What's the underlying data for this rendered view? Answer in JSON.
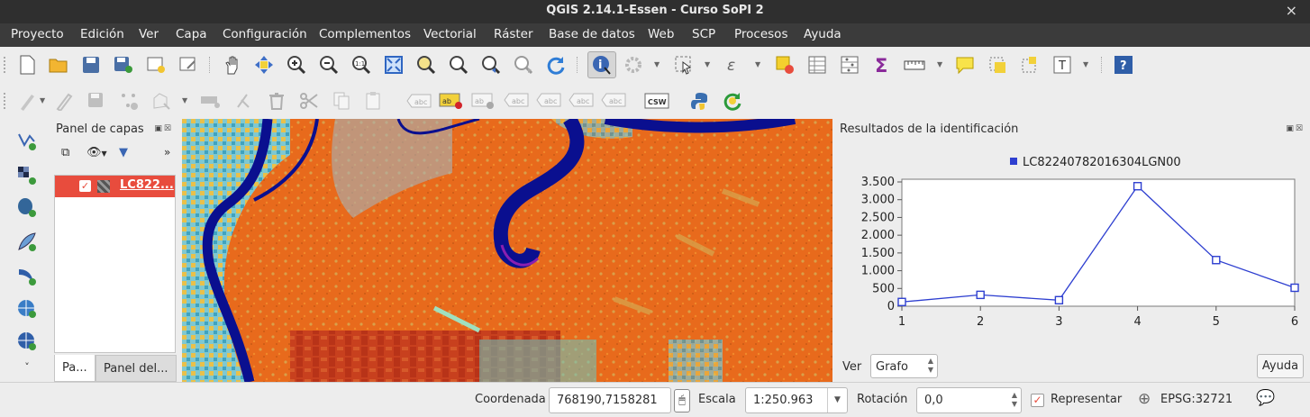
{
  "window": {
    "title": "QGIS 2.14.1-Essen - Curso SoPI 2",
    "close_glyph": "×"
  },
  "menu": [
    {
      "label": "Proyecto"
    },
    {
      "label": "Edición"
    },
    {
      "label": "Ver"
    },
    {
      "label": "Capa"
    },
    {
      "label": "Configuración"
    },
    {
      "label": "Complementos"
    },
    {
      "label": "Vectorial"
    },
    {
      "label": "Ráster"
    },
    {
      "label": "Base de datos"
    },
    {
      "label": "Web"
    },
    {
      "label": "SCP"
    },
    {
      "label": "Procesos"
    },
    {
      "label": "Ayuda"
    }
  ],
  "layers_panel": {
    "title": "Panel de capas",
    "layer_name": "LC822...",
    "tab_layers": "Pa...",
    "tab_browser": "Panel del..."
  },
  "identify_panel": {
    "title": "Resultados de la identificación",
    "view_label": "Ver",
    "view_value": "Grafo",
    "help_button": "Ayuda"
  },
  "chart_data": {
    "type": "line",
    "series": [
      {
        "name": "LC82240782016304LGN00",
        "x": [
          1,
          2,
          3,
          4,
          5,
          6
        ],
        "values": [
          120,
          320,
          170,
          3380,
          1300,
          520
        ]
      }
    ],
    "x_ticks": [
      "1",
      "2",
      "3",
      "4",
      "5",
      "6"
    ],
    "y_ticks": [
      "0",
      "500",
      "1.000",
      "1.500",
      "2.000",
      "2.500",
      "3.000",
      "3.500"
    ],
    "xlim": [
      1,
      6
    ],
    "ylim": [
      0,
      3500
    ],
    "color": "#2e3fd0",
    "grid": false,
    "legend": "top-center"
  },
  "status": {
    "coord_label": "Coordenada",
    "coord_value": "768190,7158281",
    "scale_label": "Escala",
    "scale_value": "1:250.963",
    "rotation_label": "Rotación",
    "rotation_value": "0,0",
    "render_label": "Representar",
    "crs": "EPSG:32721"
  },
  "colors": {
    "accent": "#e84c3d",
    "map_orange": "#e86a1c",
    "river": "#0a0f8f"
  }
}
